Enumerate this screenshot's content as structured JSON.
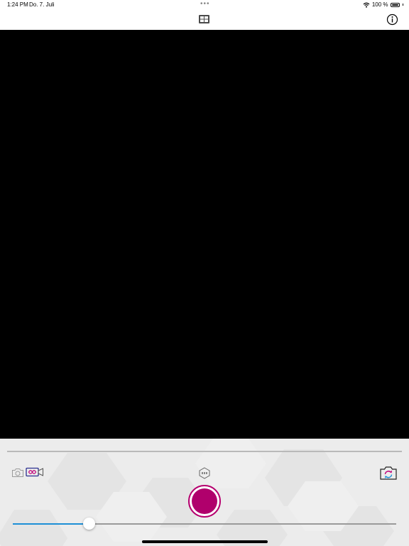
{
  "status_bar": {
    "time": "1:24 PM",
    "date": "Do. 7. Juli",
    "multitasking_dots": "•••",
    "battery_percent": "100 %",
    "battery_level": 1.0,
    "icons": [
      "wifi-icon",
      "battery-icon"
    ]
  },
  "toolbar": {
    "gallery_icon": "gallery-icon",
    "info_icon": "info-icon"
  },
  "controls": {
    "modes": [
      "photo",
      "video"
    ],
    "selected_mode": "video",
    "mode_icons": [
      "camera-icon",
      "video-camera-icon"
    ],
    "settings_icon": "hexagon-settings-icon",
    "switch_camera_icon": "switch-camera-icon",
    "shutter_icon": "record-button",
    "zoom_level": 0.2
  },
  "colors": {
    "accent": "#b0006c",
    "slider_fill": "#1d8fd6",
    "preview_bg": "#000000",
    "panel_bg": "#ececec",
    "mode_active": "#2b2f8f"
  }
}
